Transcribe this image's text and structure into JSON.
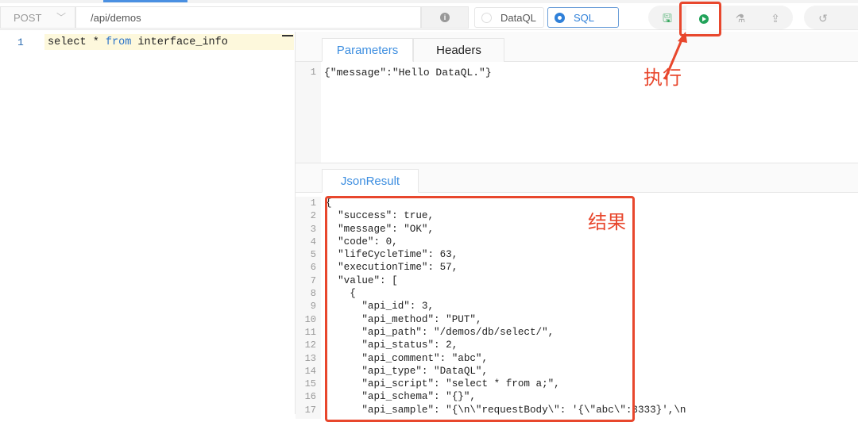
{
  "toolbar": {
    "method": "POST",
    "url": "/api/demos",
    "modes": [
      "DataQL",
      "SQL"
    ],
    "selected_mode": "SQL"
  },
  "editor": {
    "line_number": "1",
    "code_parts": [
      "select * ",
      "from",
      " interface_info"
    ]
  },
  "params": {
    "tabs": [
      "Parameters",
      "Headers"
    ],
    "active_tab": "Parameters",
    "line_number": "1",
    "content": "{\"message\":\"Hello DataQL.\"}"
  },
  "result": {
    "tab": "JsonResult",
    "lines": [
      "{",
      "  \"success\": true,",
      "  \"message\": \"OK\",",
      "  \"code\": 0,",
      "  \"lifeCycleTime\": 63,",
      "  \"executionTime\": 57,",
      "  \"value\": [",
      "    {",
      "      \"api_id\": 3,",
      "      \"api_method\": \"PUT\",",
      "      \"api_path\": \"/demos/db/select/\",",
      "      \"api_status\": 2,",
      "      \"api_comment\": \"abc\",",
      "      \"api_type\": \"DataQL\",",
      "      \"api_script\": \"select * from a;\",",
      "      \"api_schema\": \"{}\",",
      "      \"api_sample\": \"{\\n\\\"requestBody\\\": '{\\\"abc\\\":3333}',\\n"
    ],
    "line_numbers": [
      "1",
      "2",
      "3",
      "4",
      "5",
      "6",
      "7",
      "8",
      "9",
      "10",
      "11",
      "12",
      "13",
      "14",
      "15",
      "16",
      "17"
    ]
  },
  "annotations": {
    "execute": "执行",
    "result": "结果",
    "color": "#e8472d"
  }
}
